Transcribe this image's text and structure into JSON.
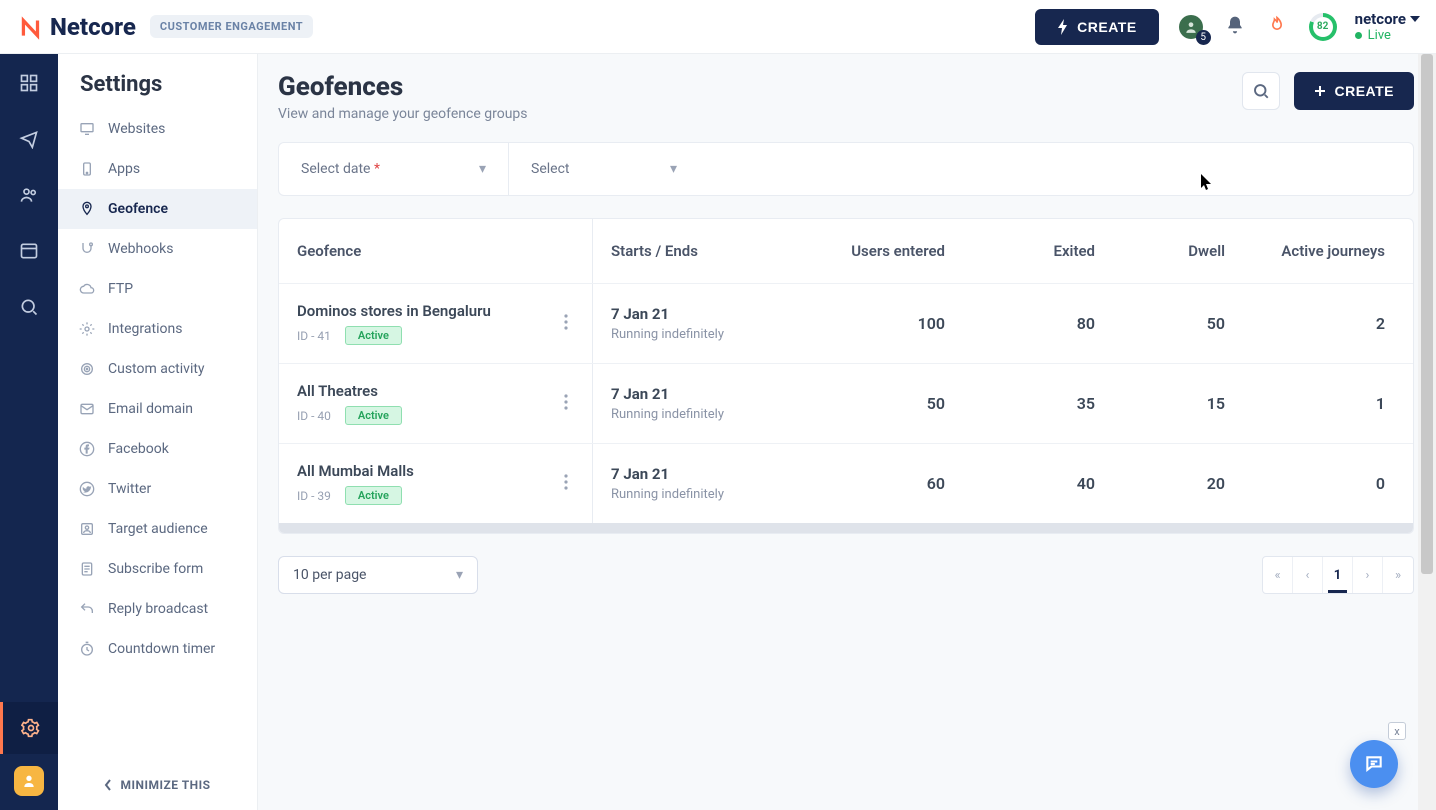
{
  "brand": {
    "name": "Netcore",
    "module": "CUSTOMER ENGAGEMENT"
  },
  "header": {
    "create": "CREATE",
    "notif_count": "5",
    "score": "82",
    "org_name": "netcore",
    "org_status": "Live"
  },
  "sidebar": {
    "title": "Settings",
    "items": [
      {
        "label": "Websites",
        "icon": "monitor-icon"
      },
      {
        "label": "Apps",
        "icon": "phone-icon"
      },
      {
        "label": "Geofence",
        "icon": "pin-icon",
        "active": true
      },
      {
        "label": "Webhooks",
        "icon": "hook-icon"
      },
      {
        "label": "FTP",
        "icon": "cloud-icon"
      },
      {
        "label": "Integrations",
        "icon": "gear-integr-icon"
      },
      {
        "label": "Custom activity",
        "icon": "target-icon"
      },
      {
        "label": "Email domain",
        "icon": "mail-icon"
      },
      {
        "label": "Facebook",
        "icon": "facebook-icon"
      },
      {
        "label": "Twitter",
        "icon": "twitter-icon"
      },
      {
        "label": "Target audience",
        "icon": "audience-icon"
      },
      {
        "label": "Subscribe form",
        "icon": "form-icon"
      },
      {
        "label": "Reply broadcast",
        "icon": "reply-icon"
      },
      {
        "label": "Countdown timer",
        "icon": "timer-icon"
      }
    ],
    "minimize": "MINIMIZE THIS"
  },
  "page": {
    "title": "Geofences",
    "subtitle": "View and manage your geofence groups",
    "create": "CREATE"
  },
  "filters": {
    "date_label": "Select date",
    "select_label": "Select"
  },
  "table": {
    "columns": [
      "Geofence",
      "Starts / Ends",
      "Users entered",
      "Exited",
      "Dwell",
      "Active journeys"
    ],
    "rows": [
      {
        "name": "Dominos stores in Bengaluru",
        "id": "ID - 41",
        "status": "Active",
        "date": "7 Jan 21",
        "running": "Running indefinitely",
        "entered": "100",
        "exited": "80",
        "dwell": "50",
        "journeys": "2"
      },
      {
        "name": "All Theatres",
        "id": "ID - 40",
        "status": "Active",
        "date": "7 Jan 21",
        "running": "Running indefinitely",
        "entered": "50",
        "exited": "35",
        "dwell": "15",
        "journeys": "1"
      },
      {
        "name": "All Mumbai Malls",
        "id": "ID - 39",
        "status": "Active",
        "date": "7 Jan 21",
        "running": "Running indefinitely",
        "entered": "60",
        "exited": "40",
        "dwell": "20",
        "journeys": "0"
      }
    ]
  },
  "pagination": {
    "per_page": "10 per page",
    "current": "1"
  },
  "chat_close": "x"
}
